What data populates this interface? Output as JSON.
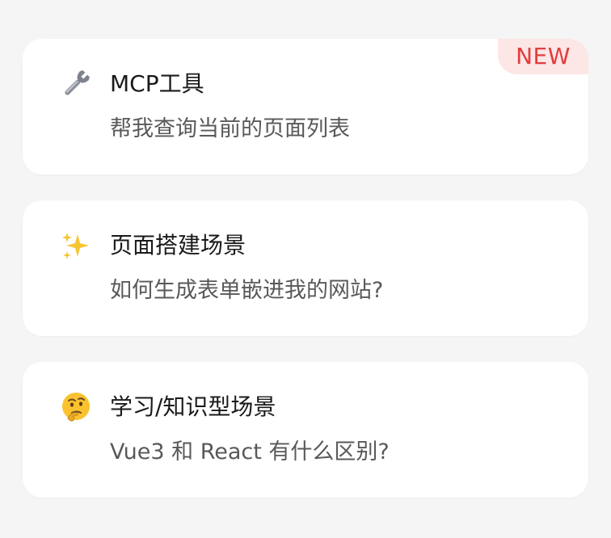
{
  "cards": [
    {
      "title": "MCP工具",
      "description": "帮我查询当前的页面列表",
      "badge": "NEW",
      "icon": "wrench-icon"
    },
    {
      "title": "页面搭建场景",
      "description": "如何生成表单嵌进我的网站?",
      "icon": "sparkles-icon"
    },
    {
      "title": "学习/知识型场景",
      "description": "Vue3 和 React 有什么区别?",
      "icon": "thinking-face-icon"
    }
  ],
  "colors": {
    "background": "#f5f5f5",
    "card": "#ffffff",
    "title": "#1a1a1a",
    "description": "#595959",
    "badge_bg": "#fde6e6",
    "badge_text": "#e23d3d"
  }
}
